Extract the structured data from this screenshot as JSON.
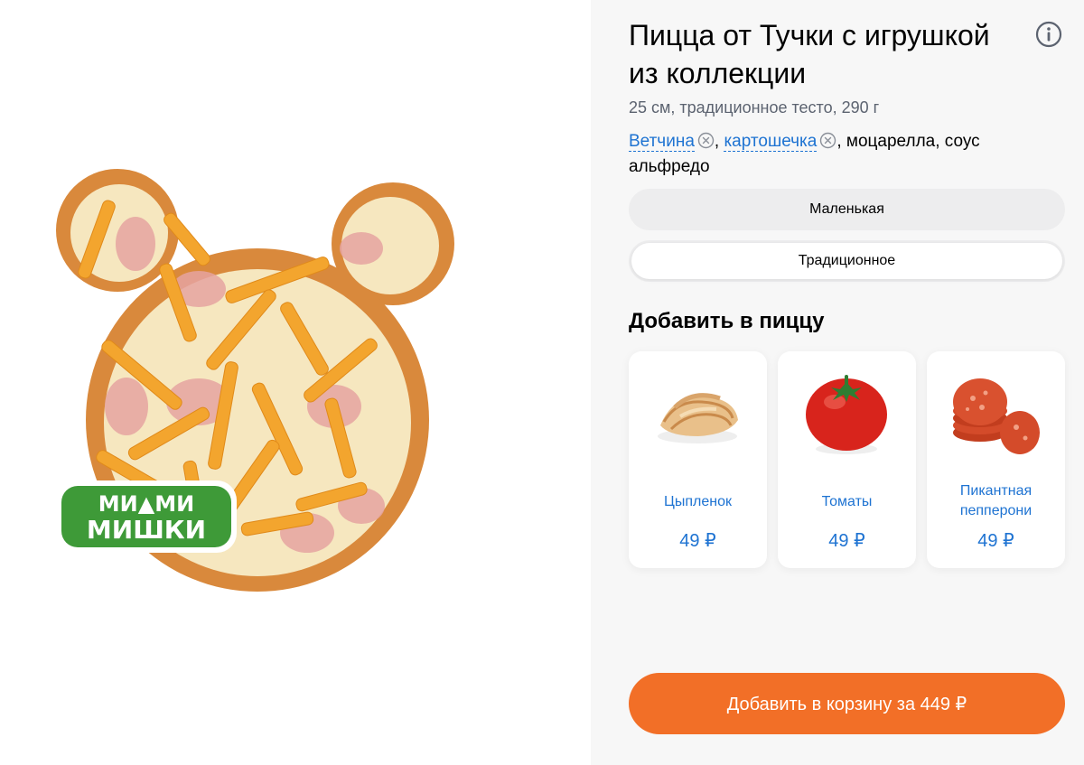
{
  "product": {
    "title": "Пицца от Тучки с игрушкой из коллекции",
    "subtitle": "25 см, традиционное тесто, 290 г",
    "logo_text": "МИМИМИШКИ",
    "ingredients": {
      "removable": [
        {
          "label": "Ветчина",
          "icon": "remove-icon"
        },
        {
          "label": "картошечка",
          "icon": "remove-icon"
        }
      ],
      "sep1": ", ",
      "rest": ", моцарелла, соус альфредо"
    }
  },
  "options": {
    "size": "Маленькая",
    "dough": "Традиционное"
  },
  "toppings_section": {
    "title": "Добавить в пиццу",
    "items": [
      {
        "name": "Цыпленок",
        "price": "49 ₽",
        "icon": "chicken-icon"
      },
      {
        "name": "Томаты",
        "price": "49 ₽",
        "icon": "tomato-icon"
      },
      {
        "name": "Пикантная пепперони",
        "price": "49 ₽",
        "icon": "pepperoni-icon"
      }
    ]
  },
  "cart": {
    "label": "Добавить в корзину за 449 ₽"
  },
  "colors": {
    "accent_orange": "#f26f27",
    "link_blue": "#1e73d2",
    "panel_bg": "#f7f7f7",
    "muted_text": "#5c6370"
  }
}
